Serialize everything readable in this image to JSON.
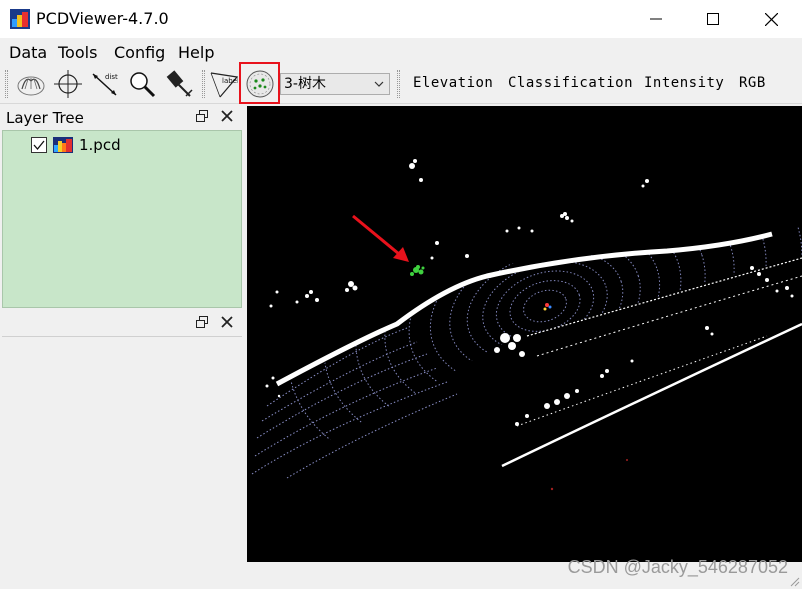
{
  "window": {
    "title": "PCDViewer-4.7.0"
  },
  "menubar": {
    "items": [
      "Data",
      "Tools",
      "Config",
      "Help"
    ]
  },
  "toolbar": {
    "tools": [
      "point-view-icon",
      "crosshair-icon",
      "distance-icon",
      "zoom-icon",
      "brush-icon",
      "label-icon",
      "classify-tree-icon"
    ],
    "distance_text": "dist",
    "label_text": "label",
    "class_select_value": "3-树木",
    "view_modes": [
      "Elevation",
      "Classification",
      "Intensity",
      "RGB"
    ],
    "highlight_color": "#e8121c"
  },
  "layer_tree": {
    "title": "Layer Tree",
    "layers": [
      {
        "name": "1.pcd",
        "checked": true
      }
    ],
    "background": "#c8e6c9"
  },
  "second_dock": {
    "title": ""
  },
  "viewer": {
    "background": "#000000",
    "road_color": "#8a8fc8",
    "selected_point_color": "#3fd13f",
    "arrow_color": "#e8121c"
  },
  "watermark": "CSDN @Jacky_546287052"
}
